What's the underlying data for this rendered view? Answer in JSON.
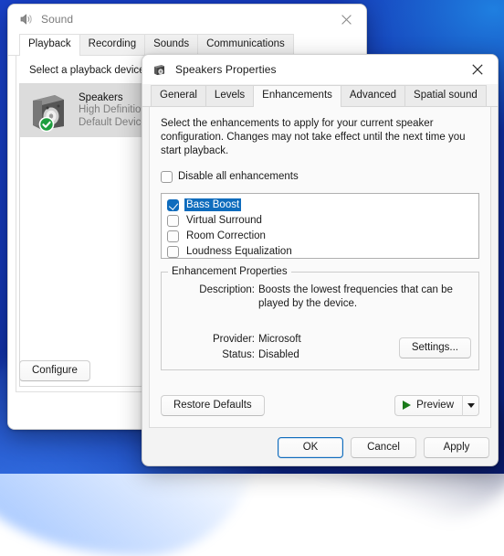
{
  "desktop": {
    "wallpaper_color": "#1437b4"
  },
  "sound_window": {
    "title": "Sound",
    "icon": "speaker-icon",
    "close_label": "Close",
    "tabs": [
      {
        "label": "Playback",
        "active": true
      },
      {
        "label": "Recording",
        "active": false
      },
      {
        "label": "Sounds",
        "active": false
      },
      {
        "label": "Communications",
        "active": false
      }
    ],
    "pane_label": "Select a playback device",
    "devices": [
      {
        "name": "Speakers",
        "line2": "High Definition Audio Device",
        "line3": "Default Device",
        "icon": "speaker-box-icon",
        "badge": "check-badge",
        "selected": true
      }
    ],
    "configure_label": "Configure"
  },
  "props_dialog": {
    "title": "Speakers Properties",
    "icon": "speaker-icon",
    "close_label": "Close",
    "tabs": [
      {
        "label": "General",
        "active": false
      },
      {
        "label": "Levels",
        "active": false
      },
      {
        "label": "Enhancements",
        "active": true
      },
      {
        "label": "Advanced",
        "active": false
      },
      {
        "label": "Spatial sound",
        "active": false
      }
    ],
    "description": "Select the enhancements to apply for your current speaker configuration. Changes may not take effect until the next time you start playback.",
    "disable_all": {
      "label": "Disable all enhancements",
      "checked": false
    },
    "enhancements": [
      {
        "label": "Bass Boost",
        "checked": true,
        "selected": true
      },
      {
        "label": "Virtual Surround",
        "checked": false,
        "selected": false
      },
      {
        "label": "Room Correction",
        "checked": false,
        "selected": false
      },
      {
        "label": "Loudness Equalization",
        "checked": false,
        "selected": false
      }
    ],
    "properties_group": {
      "title": "Enhancement Properties",
      "description_key": "Description:",
      "description_value": "Boosts the lowest frequencies that can be played by the device.",
      "provider_key": "Provider:",
      "provider_value": "Microsoft",
      "status_key": "Status:",
      "status_value": "Disabled",
      "settings_label": "Settings..."
    },
    "restore_defaults_label": "Restore Defaults",
    "preview": {
      "label": "Preview",
      "play_icon": "play-icon",
      "dropdown_icon": "chevron-down-icon"
    },
    "footer_buttons": [
      {
        "label": "OK",
        "default": true
      },
      {
        "label": "Cancel",
        "default": false
      },
      {
        "label": "Apply",
        "default": false
      }
    ]
  },
  "accent_color": "#0f6cbd",
  "play_color": "#1a7a1a"
}
